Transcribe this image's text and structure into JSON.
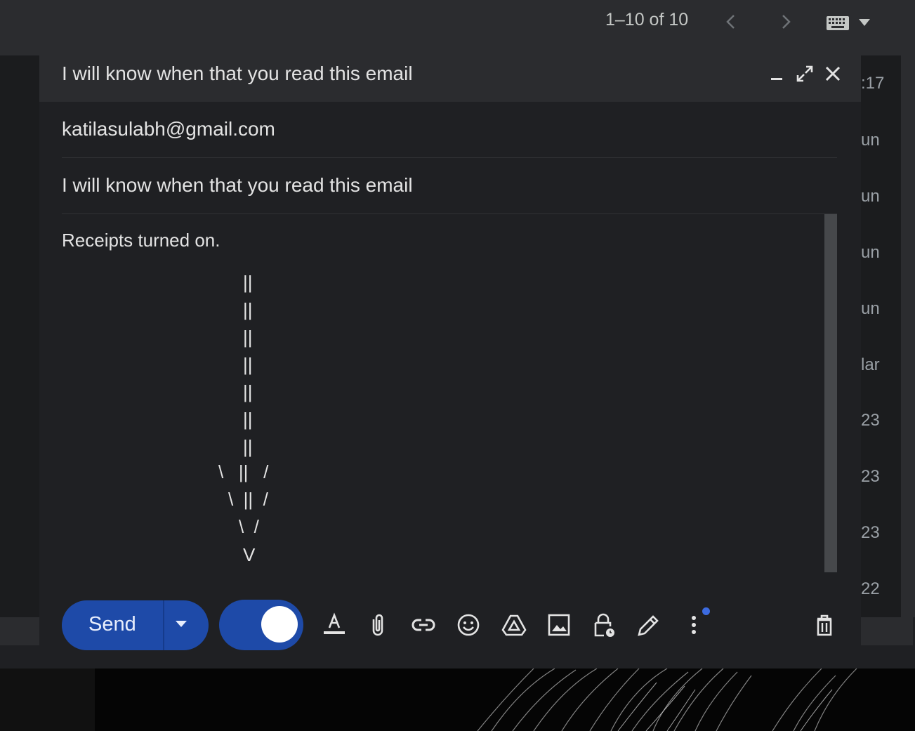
{
  "topbar": {
    "pager_text": "1–10 of 10",
    "prev_icon": "chevron-left-icon",
    "next_icon": "chevron-right-icon",
    "keyboard_icon": "keyboard-icon"
  },
  "background_dates": [
    ":17",
    "un",
    "un",
    "un",
    "un",
    "lar",
    "23",
    "23",
    "23",
    "22"
  ],
  "compose": {
    "title": "I will know when that you read this email",
    "to": "katilasulabh@gmail.com",
    "subject": "I will know when that you read this email",
    "body_text": "Receipts turned on.",
    "arrow_lines": [
      "||",
      "||",
      "||",
      "||",
      "||",
      "||",
      "||",
      "\\   ||   /",
      "\\  ||  /",
      "\\  /",
      "V"
    ],
    "send_label": "Send",
    "toggle_on": true,
    "accent_color": "#1e4aa8",
    "toolbar_icons": [
      "text-format-icon",
      "attach-icon",
      "link-icon",
      "emoji-icon",
      "drive-icon",
      "image-icon",
      "confidential-lock-icon",
      "signature-pen-icon",
      "more-options-icon",
      "trash-icon"
    ]
  }
}
